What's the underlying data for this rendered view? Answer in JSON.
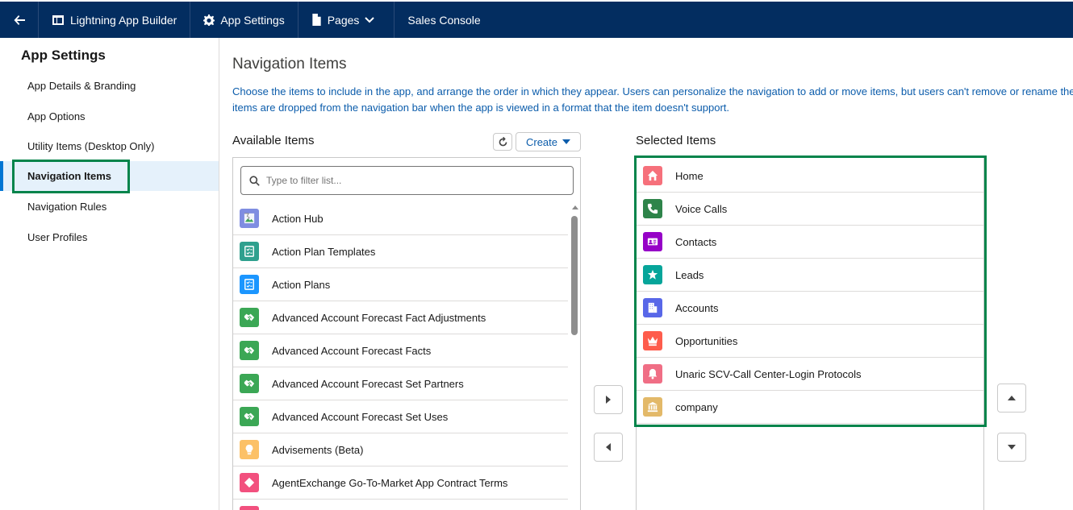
{
  "topbar": {
    "back_icon": "arrow-left-icon",
    "app_builder": "Lightning App Builder",
    "app_settings": "App Settings",
    "pages": "Pages",
    "app_name": "Sales Console"
  },
  "sidebar": {
    "title": "App Settings",
    "items": [
      {
        "label": "App Details & Branding"
      },
      {
        "label": "App Options"
      },
      {
        "label": "Utility Items (Desktop Only)"
      },
      {
        "label": "Navigation Items"
      },
      {
        "label": "Navigation Rules"
      },
      {
        "label": "User Profiles"
      }
    ],
    "active_index": 3
  },
  "main": {
    "title": "Navigation Items",
    "description_line1": "Choose the items to include in the app, and arrange the order in which they appear. Users can personalize the navigation to add or move items, but users can't remove or rename the",
    "description_line2": "items are dropped from the navigation bar when the app is viewed in a format that the item doesn't support.",
    "available_title": "Available Items",
    "create_label": "Create",
    "filter_placeholder": "Type to filter list...",
    "selected_title": "Selected Items",
    "available_items": [
      {
        "label": "Action Hub",
        "icon": "broken-image-icon",
        "color": "#7f8de1"
      },
      {
        "label": "Action Plan Templates",
        "icon": "checklist-icon",
        "color": "#2fa08e"
      },
      {
        "label": "Action Plans",
        "icon": "checklist-icon",
        "color": "#1b96ff"
      },
      {
        "label": "Advanced Account Forecast Fact Adjustments",
        "icon": "handshake-icon",
        "color": "#3ba755"
      },
      {
        "label": "Advanced Account Forecast Facts",
        "icon": "handshake-icon",
        "color": "#3ba755"
      },
      {
        "label": "Advanced Account Forecast Set Partners",
        "icon": "handshake-icon",
        "color": "#3ba755"
      },
      {
        "label": "Advanced Account Forecast Set Uses",
        "icon": "handshake-icon",
        "color": "#3ba755"
      },
      {
        "label": "Advisements (Beta)",
        "icon": "lightbulb-icon",
        "color": "#fcc167"
      },
      {
        "label": "AgentExchange Go-To-Market App Contract Terms",
        "icon": "diamond-icon",
        "color": "#f2507e"
      },
      {
        "label": "",
        "icon": "generic-icon",
        "color": "#f2507e"
      }
    ],
    "selected_items": [
      {
        "label": "Home",
        "icon": "home-icon",
        "color": "#f6707b"
      },
      {
        "label": "Voice Calls",
        "icon": "phone-icon",
        "color": "#2e844a"
      },
      {
        "label": "Contacts",
        "icon": "contact-card-icon",
        "color": "#9602c7"
      },
      {
        "label": "Leads",
        "icon": "lead-star-icon",
        "color": "#06a59a"
      },
      {
        "label": "Accounts",
        "icon": "building-icon",
        "color": "#5867e8"
      },
      {
        "label": "Opportunities",
        "icon": "crown-icon",
        "color": "#fe5c4c"
      },
      {
        "label": "Unaric SCV-Call Center-Login Protocols",
        "icon": "bell-icon",
        "color": "#f06e85"
      },
      {
        "label": "company",
        "icon": "bank-icon",
        "color": "#e3b969"
      }
    ]
  }
}
